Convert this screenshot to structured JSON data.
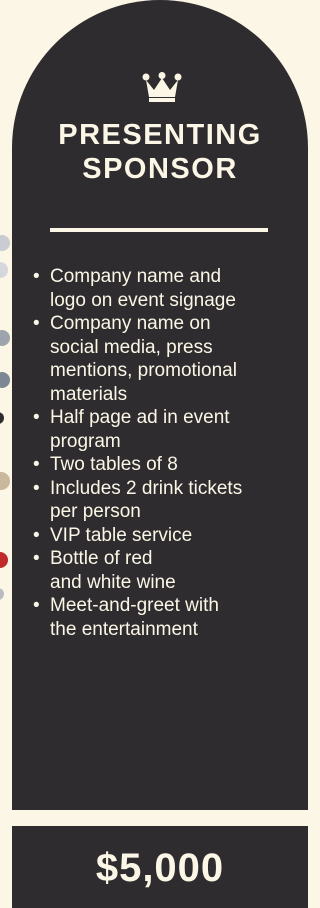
{
  "card": {
    "icon": "crown-icon",
    "title_line1": "PRESENTING",
    "title_line2": "SPONSOR",
    "benefits": [
      {
        "line1": "Company name and",
        "line2": "logo on event signage"
      },
      {
        "line1": "Company name on",
        "line2": "social media, press",
        "line3": "mentions, promotional",
        "line4": "materials"
      },
      {
        "line1": "Half page ad in event",
        "line2": "program"
      },
      {
        "line1": "Two tables of 8"
      },
      {
        "line1": "Includes 2 drink tickets",
        "line2": "per person"
      },
      {
        "line1": "VIP table service"
      },
      {
        "line1": "Bottle of red",
        "line2": "and white wine"
      },
      {
        "line1": "Meet-and-greet with",
        "line2": "the entertainment"
      }
    ]
  },
  "price": "$5,000",
  "colors": {
    "background": "#fbf6e6",
    "card": "#2e2c2f",
    "text": "#fbf6e6",
    "dot_grey": "#9ea4ab",
    "dot_slate": "#7b8793",
    "dot_tan": "#c9b89c",
    "dot_red": "#c02a2a"
  }
}
